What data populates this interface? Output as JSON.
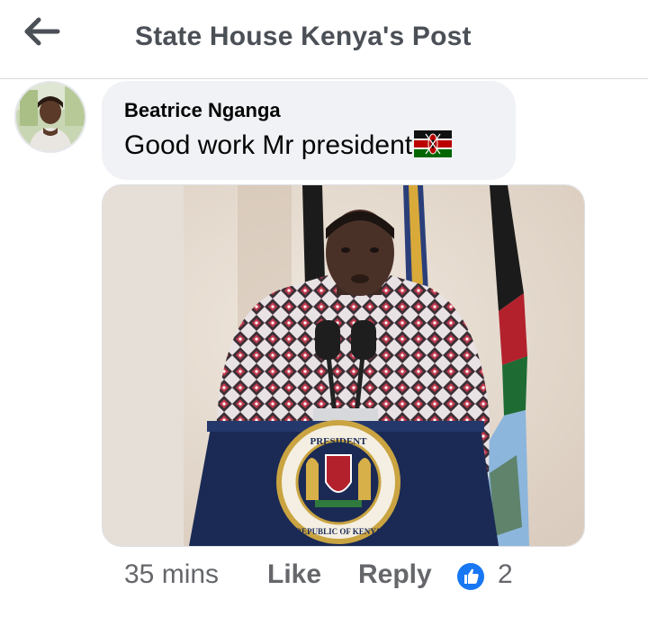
{
  "header": {
    "title": "State House Kenya's Post",
    "back_icon": "arrow-left-icon"
  },
  "comment": {
    "author": "Beatrice Nganga",
    "text": "Good work Mr president",
    "emoji": "kenya-flag-icon",
    "avatar_icon": "profile-photo",
    "attachment": "photo-president-at-podium"
  },
  "photo": {
    "seal_text_top": "PRESIDENT",
    "seal_text_bottom": "REPUBLIC OF KENYA"
  },
  "actions": {
    "time": "35 mins",
    "like_label": "Like",
    "reply_label": "Reply",
    "reaction_icon": "thumbs-up-icon",
    "reaction_count": "2"
  },
  "colors": {
    "bubble_bg": "#f0f2f5",
    "secondary_text": "#65676b",
    "header_text": "#4b4f56",
    "like_blue": "#1877f2"
  }
}
